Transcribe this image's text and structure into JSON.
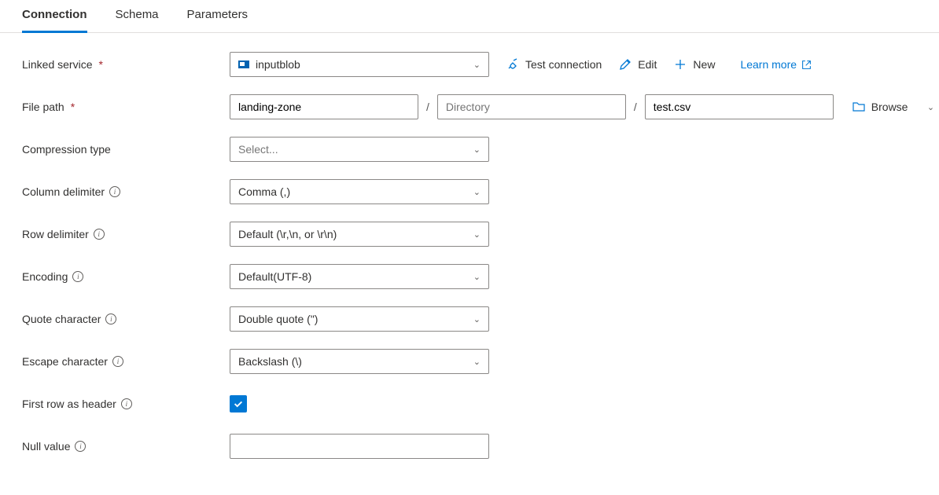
{
  "tabs": {
    "connection": "Connection",
    "schema": "Schema",
    "parameters": "Parameters"
  },
  "labels": {
    "linked_service": "Linked service",
    "file_path": "File path",
    "compression_type": "Compression type",
    "column_delimiter": "Column delimiter",
    "row_delimiter": "Row delimiter",
    "encoding": "Encoding",
    "quote_character": "Quote character",
    "escape_character": "Escape character",
    "first_row_header": "First row as header",
    "null_value": "Null value"
  },
  "values": {
    "linked_service": "inputblob",
    "file_path_container": "landing-zone",
    "file_path_directory_placeholder": "Directory",
    "file_path_file": "test.csv",
    "compression_type": "Select...",
    "column_delimiter": "Comma (,)",
    "row_delimiter": "Default (\\r,\\n, or \\r\\n)",
    "encoding": "Default(UTF-8)",
    "quote_character": "Double quote (\")",
    "escape_character": "Backslash (\\)",
    "null_value": ""
  },
  "actions": {
    "test_connection": "Test connection",
    "edit": "Edit",
    "new": "New",
    "learn_more": "Learn more",
    "browse": "Browse"
  },
  "separator": "/"
}
